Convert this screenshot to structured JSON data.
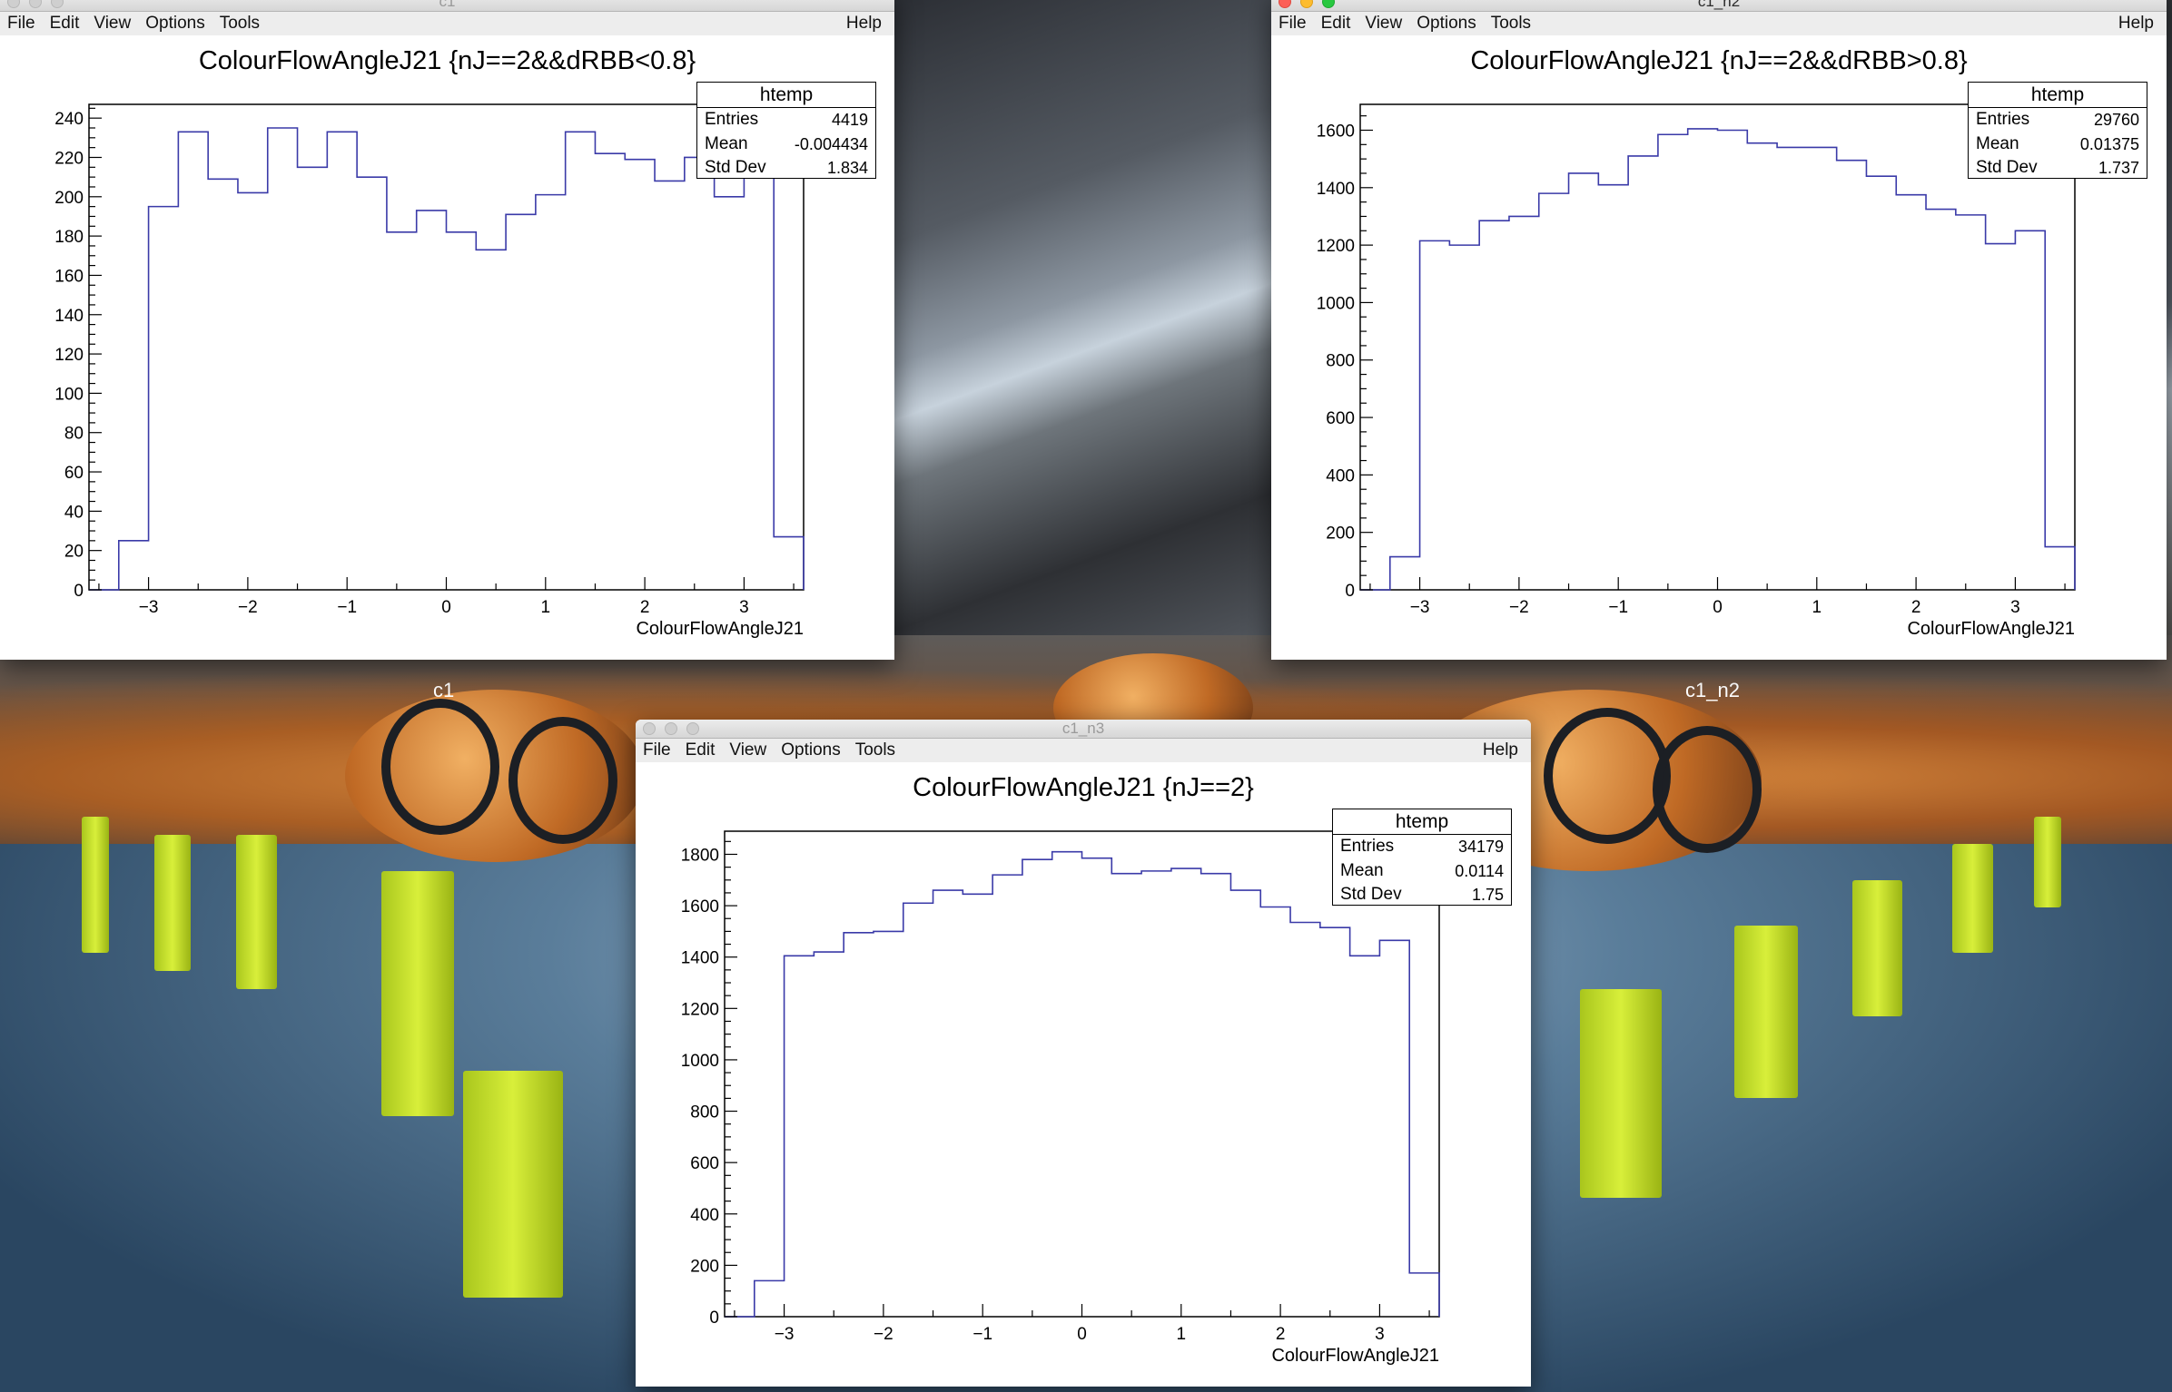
{
  "desktop": {
    "labels": [
      "c1",
      "c1_n2"
    ]
  },
  "windows": [
    {
      "id": "c1",
      "title": "c1",
      "menu": [
        "File",
        "Edit",
        "View",
        "Options",
        "Tools"
      ],
      "help": "Help",
      "hist": {
        "title": "ColourFlowAngleJ21 {nJ==2&&dRBB<0.8}",
        "stats": {
          "name": "htemp",
          "entries_label": "Entries",
          "entries": "4419",
          "mean_label": "Mean",
          "mean": "-0.004434",
          "std_label": "Std Dev",
          "std": "1.834"
        }
      }
    },
    {
      "id": "c1_n2",
      "title": "c1_n2",
      "menu": [
        "File",
        "Edit",
        "View",
        "Options",
        "Tools"
      ],
      "help": "Help",
      "hist": {
        "title": "ColourFlowAngleJ21 {nJ==2&&dRBB>0.8}",
        "stats": {
          "name": "htemp",
          "entries_label": "Entries",
          "entries": "29760",
          "mean_label": "Mean",
          "mean": "0.01375",
          "std_label": "Std Dev",
          "std": "1.737"
        }
      }
    },
    {
      "id": "c1_n3",
      "title": "c1_n3",
      "menu": [
        "File",
        "Edit",
        "View",
        "Options",
        "Tools"
      ],
      "help": "Help",
      "hist": {
        "title": "ColourFlowAngleJ21 {nJ==2}",
        "stats": {
          "name": "htemp",
          "entries_label": "Entries",
          "entries": "34179",
          "mean_label": "Mean",
          "mean": "0.0114",
          "std_label": "Std Dev",
          "std": "1.75"
        }
      }
    }
  ],
  "chart_data": [
    {
      "type": "histogram",
      "title": "ColourFlowAngleJ21 {nJ==2&&dRBB<0.8}",
      "xlabel": "ColourFlowAngleJ21",
      "ylabel": "",
      "xlim": [
        -3.6,
        3.6
      ],
      "ylim": [
        0,
        247
      ],
      "x_ticks": [
        -3,
        -2,
        -1,
        0,
        1,
        2,
        3
      ],
      "y_ticks": [
        0,
        20,
        40,
        60,
        80,
        100,
        120,
        140,
        160,
        180,
        200,
        220,
        240
      ],
      "bin_edges": [
        -3.6,
        -3.3,
        -3.0,
        -2.7,
        -2.4,
        -2.1,
        -1.8,
        -1.5,
        -1.2,
        -0.9,
        -0.6,
        -0.3,
        0.0,
        0.3,
        0.6,
        0.9,
        1.2,
        1.5,
        1.8,
        2.1,
        2.4,
        2.7,
        3.0,
        3.3,
        3.6
      ],
      "values": [
        0,
        25,
        195,
        233,
        209,
        202,
        235,
        215,
        233,
        210,
        182,
        193,
        182,
        173,
        191,
        201,
        233,
        222,
        219,
        208,
        220,
        200,
        215,
        27,
        0
      ],
      "color": "#3a3aa8"
    },
    {
      "type": "histogram",
      "title": "ColourFlowAngleJ21 {nJ==2&&dRBB>0.8}",
      "xlabel": "ColourFlowAngleJ21",
      "ylabel": "",
      "xlim": [
        -3.6,
        3.6
      ],
      "ylim": [
        0,
        1690
      ],
      "x_ticks": [
        -3,
        -2,
        -1,
        0,
        1,
        2,
        3
      ],
      "y_ticks": [
        0,
        200,
        400,
        600,
        800,
        1000,
        1200,
        1400,
        1600
      ],
      "bin_edges": [
        -3.6,
        -3.3,
        -3.0,
        -2.7,
        -2.4,
        -2.1,
        -1.8,
        -1.5,
        -1.2,
        -0.9,
        -0.6,
        -0.3,
        0.0,
        0.3,
        0.6,
        0.9,
        1.2,
        1.5,
        1.8,
        2.1,
        2.4,
        2.7,
        3.0,
        3.3,
        3.6
      ],
      "values": [
        0,
        115,
        1215,
        1200,
        1285,
        1300,
        1380,
        1450,
        1410,
        1510,
        1585,
        1605,
        1600,
        1555,
        1540,
        1540,
        1495,
        1440,
        1375,
        1325,
        1305,
        1205,
        1250,
        150,
        0
      ],
      "color": "#3a3aa8"
    },
    {
      "type": "histogram",
      "title": "ColourFlowAngleJ21 {nJ==2}",
      "xlabel": "ColourFlowAngleJ21",
      "ylabel": "",
      "xlim": [
        -3.6,
        3.6
      ],
      "ylim": [
        0,
        1890
      ],
      "x_ticks": [
        -3,
        -2,
        -1,
        0,
        1,
        2,
        3
      ],
      "y_ticks": [
        0,
        200,
        400,
        600,
        800,
        1000,
        1200,
        1400,
        1600,
        1800
      ],
      "bin_edges": [
        -3.6,
        -3.3,
        -3.0,
        -2.7,
        -2.4,
        -2.1,
        -1.8,
        -1.5,
        -1.2,
        -0.9,
        -0.6,
        -0.3,
        0.0,
        0.3,
        0.6,
        0.9,
        1.2,
        1.5,
        1.8,
        2.1,
        2.4,
        2.7,
        3.0,
        3.3,
        3.6
      ],
      "values": [
        0,
        140,
        1405,
        1420,
        1495,
        1500,
        1610,
        1660,
        1645,
        1720,
        1780,
        1810,
        1785,
        1725,
        1735,
        1745,
        1725,
        1660,
        1595,
        1535,
        1515,
        1405,
        1465,
        170,
        0
      ],
      "color": "#3a3aa8"
    }
  ]
}
